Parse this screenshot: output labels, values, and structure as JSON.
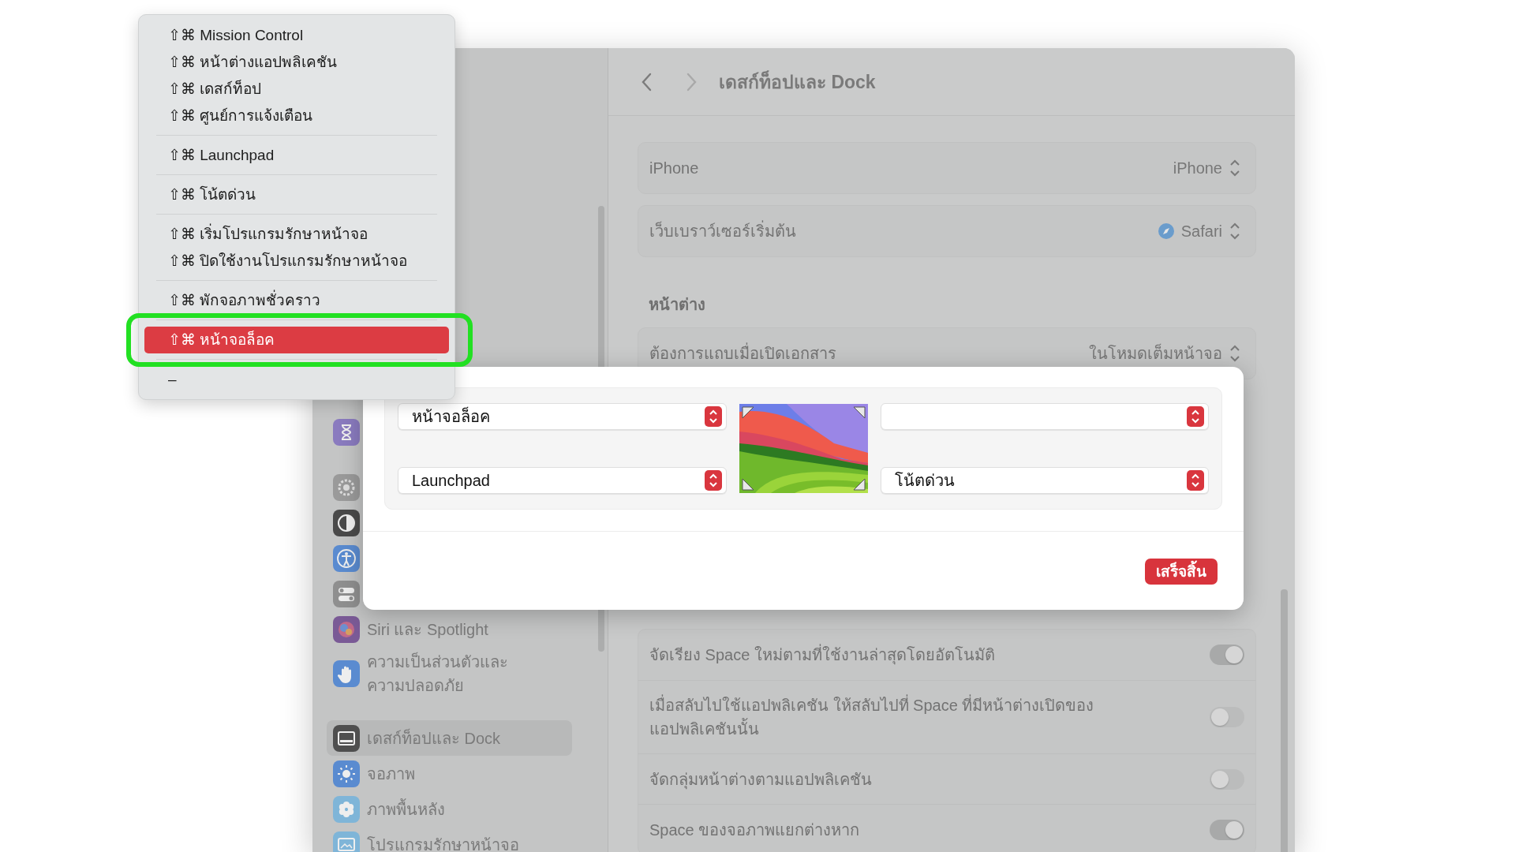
{
  "settings_window": {
    "toolbar": {
      "back_enabled": true,
      "forward_enabled": false,
      "title": "เดสก์ท็อปและ Dock"
    },
    "sidebar": {
      "groups": [
        {
          "items": [
            {
              "kind": "hourglass",
              "color": "#8a7bbf",
              "selected": false
            }
          ]
        },
        {
          "items": [
            {
              "kind": "gear",
              "color": "#9a9a9a",
              "selected": false
            },
            {
              "kind": "contrast",
              "color": "#4a4a4a",
              "selected": false
            },
            {
              "kind": "accessibility",
              "color": "#5a8bd0",
              "selected": false
            },
            {
              "kind": "toggles",
              "color": "#8f8f8f",
              "selected": false
            },
            {
              "kind": "siri",
              "color": "#7a5a96",
              "label": "Siri และ Spotlight",
              "selected": false
            },
            {
              "kind": "hand",
              "color": "#5a8bd0",
              "label": "ความเป็นส่วนตัวและความปลอดภัย",
              "selected": false
            }
          ]
        },
        {
          "items": [
            {
              "kind": "dock",
              "color": "#4f4f4f",
              "label": "เดสก์ท็อปและ Dock",
              "selected": true
            },
            {
              "kind": "sun",
              "color": "#5a8bd0",
              "label": "จอภาพ",
              "selected": false
            },
            {
              "kind": "flower",
              "color": "#7fb5d8",
              "label": "ภาพพื้นหลัง",
              "selected": false
            },
            {
              "kind": "screensaver",
              "color": "#7fb5d8",
              "label": "โปรแกรมรักษาหน้าจอ",
              "selected": false
            }
          ]
        }
      ]
    },
    "content": {
      "blocks": [
        {
          "kind": "card",
          "rows": [
            {
              "kind": "select",
              "label": "iPhone",
              "value": "iPhone"
            }
          ]
        },
        {
          "kind": "card",
          "rows": [
            {
              "kind": "app-select",
              "label": "เว็บเบราว์เซอร์เริ่มต้น",
              "value": "Safari"
            }
          ]
        },
        {
          "kind": "heading",
          "text": "หน้าต่าง"
        },
        {
          "kind": "card",
          "rows": [
            {
              "kind": "select",
              "label": "ต้องการแถบเมื่อเปิดเอกสาร",
              "value": "ในโหมดเต็มหน้าจอ"
            }
          ]
        },
        {
          "kind": "card",
          "rows": [
            {
              "kind": "toggle",
              "label": "จัดเรียง Space ใหม่ตามที่ใช้งานล่าสุดโดยอัตโนมัติ",
              "on": true
            },
            {
              "kind": "toggle",
              "label": "เมื่อสลับไปใช้แอปพลิเคชัน ให้สลับไปที่ Space ที่มีหน้าต่างเปิดของแอปพลิเคชันนั้น",
              "on": false
            },
            {
              "kind": "toggle",
              "label": "จัดกลุ่มหน้าต่างตามแอปพลิเคชัน",
              "on": false
            },
            {
              "kind": "toggle",
              "label": "Space ของจอภาพแยกต่างหาก",
              "on": true
            }
          ]
        }
      ]
    }
  },
  "hot_corners_dialog": {
    "corners": {
      "top_left": "หน้าจอล็อค",
      "bottom_left": "Launchpad",
      "bottom_right": "โน้ตด่วน"
    },
    "done_button": "เสร็จสิ้น"
  },
  "context_menu": {
    "groups": [
      {
        "items": [
          {
            "label": "⇧⌘ Mission Control",
            "selected": false,
            "circled": false
          },
          {
            "label": "⇧⌘ หน้าต่างแอปพลิเคชัน",
            "selected": false,
            "circled": false
          },
          {
            "label": "⇧⌘ เดสก์ท็อป",
            "selected": false,
            "circled": false
          },
          {
            "label": "⇧⌘ ศูนย์การแจ้งเตือน",
            "selected": false,
            "circled": false
          }
        ]
      },
      {
        "items": [
          {
            "label": "⇧⌘ Launchpad",
            "selected": false,
            "circled": false
          }
        ]
      },
      {
        "items": [
          {
            "label": "⇧⌘ โน้ตด่วน",
            "selected": false,
            "circled": false
          }
        ]
      },
      {
        "items": [
          {
            "label": "⇧⌘ เริ่มโปรแกรมรักษาหน้าจอ",
            "selected": false,
            "circled": false
          },
          {
            "label": "⇧⌘ ปิดใช้งานโปรแกรมรักษาหน้าจอ",
            "selected": false,
            "circled": false
          }
        ]
      },
      {
        "items": [
          {
            "label": "⇧⌘ พักจอภาพชั่วคราว",
            "selected": false,
            "circled": false
          }
        ]
      },
      {
        "items": [
          {
            "label": "⇧⌘ หน้าจอล็อค",
            "selected": true,
            "circled": true
          }
        ]
      },
      {
        "items": [
          {
            "label": "–",
            "selected": false,
            "circled": false
          }
        ]
      }
    ]
  }
}
